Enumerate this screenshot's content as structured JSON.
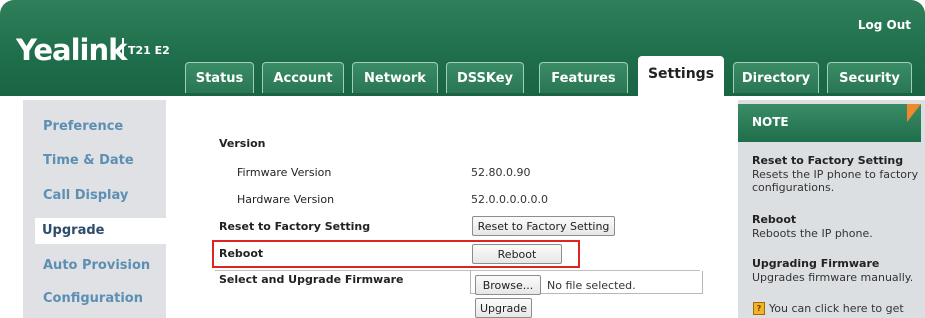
{
  "brand": {
    "logo": "Yealink",
    "model": "T21 E2"
  },
  "header": {
    "logout": "Log Out"
  },
  "tabs": [
    {
      "label": "Status"
    },
    {
      "label": "Account"
    },
    {
      "label": "Network"
    },
    {
      "label": "DSSKey"
    },
    {
      "label": "Features"
    },
    {
      "label": "Settings"
    },
    {
      "label": "Directory"
    },
    {
      "label": "Security"
    }
  ],
  "active_tab": "Settings",
  "sidebar": {
    "items": [
      {
        "label": "Preference"
      },
      {
        "label": "Time & Date"
      },
      {
        "label": "Call Display"
      },
      {
        "label": "Upgrade"
      },
      {
        "label": "Auto Provision"
      },
      {
        "label": "Configuration"
      }
    ],
    "active": "Upgrade"
  },
  "main": {
    "version_heading": "Version",
    "firmware_label": "Firmware Version",
    "firmware_value": "52.80.0.90",
    "hardware_label": "Hardware Version",
    "hardware_value": "52.0.0.0.0.0.0",
    "reset_label": "Reset to Factory Setting",
    "reset_button": "Reset to Factory Setting",
    "reboot_label": "Reboot",
    "reboot_button": "Reboot",
    "upgrade_label": "Select and Upgrade Firmware",
    "browse_button": "Browse...",
    "file_status": "No file selected.",
    "upgrade_button": "Upgrade"
  },
  "note": {
    "title": "NOTE",
    "items": [
      {
        "heading": "Reset to Factory Setting",
        "text": "Resets the IP phone to factory configurations."
      },
      {
        "heading": "Reboot",
        "text": "Reboots the IP phone."
      },
      {
        "heading": "Upgrading Firmware",
        "text": "Upgrades firmware manually."
      }
    ],
    "hint": "You can click here to get"
  },
  "colors": {
    "header_green": "#1f6e4b",
    "nav_link": "#5d8fb4",
    "highlight": "#e02424",
    "note_accent": "#ee8a2b"
  }
}
